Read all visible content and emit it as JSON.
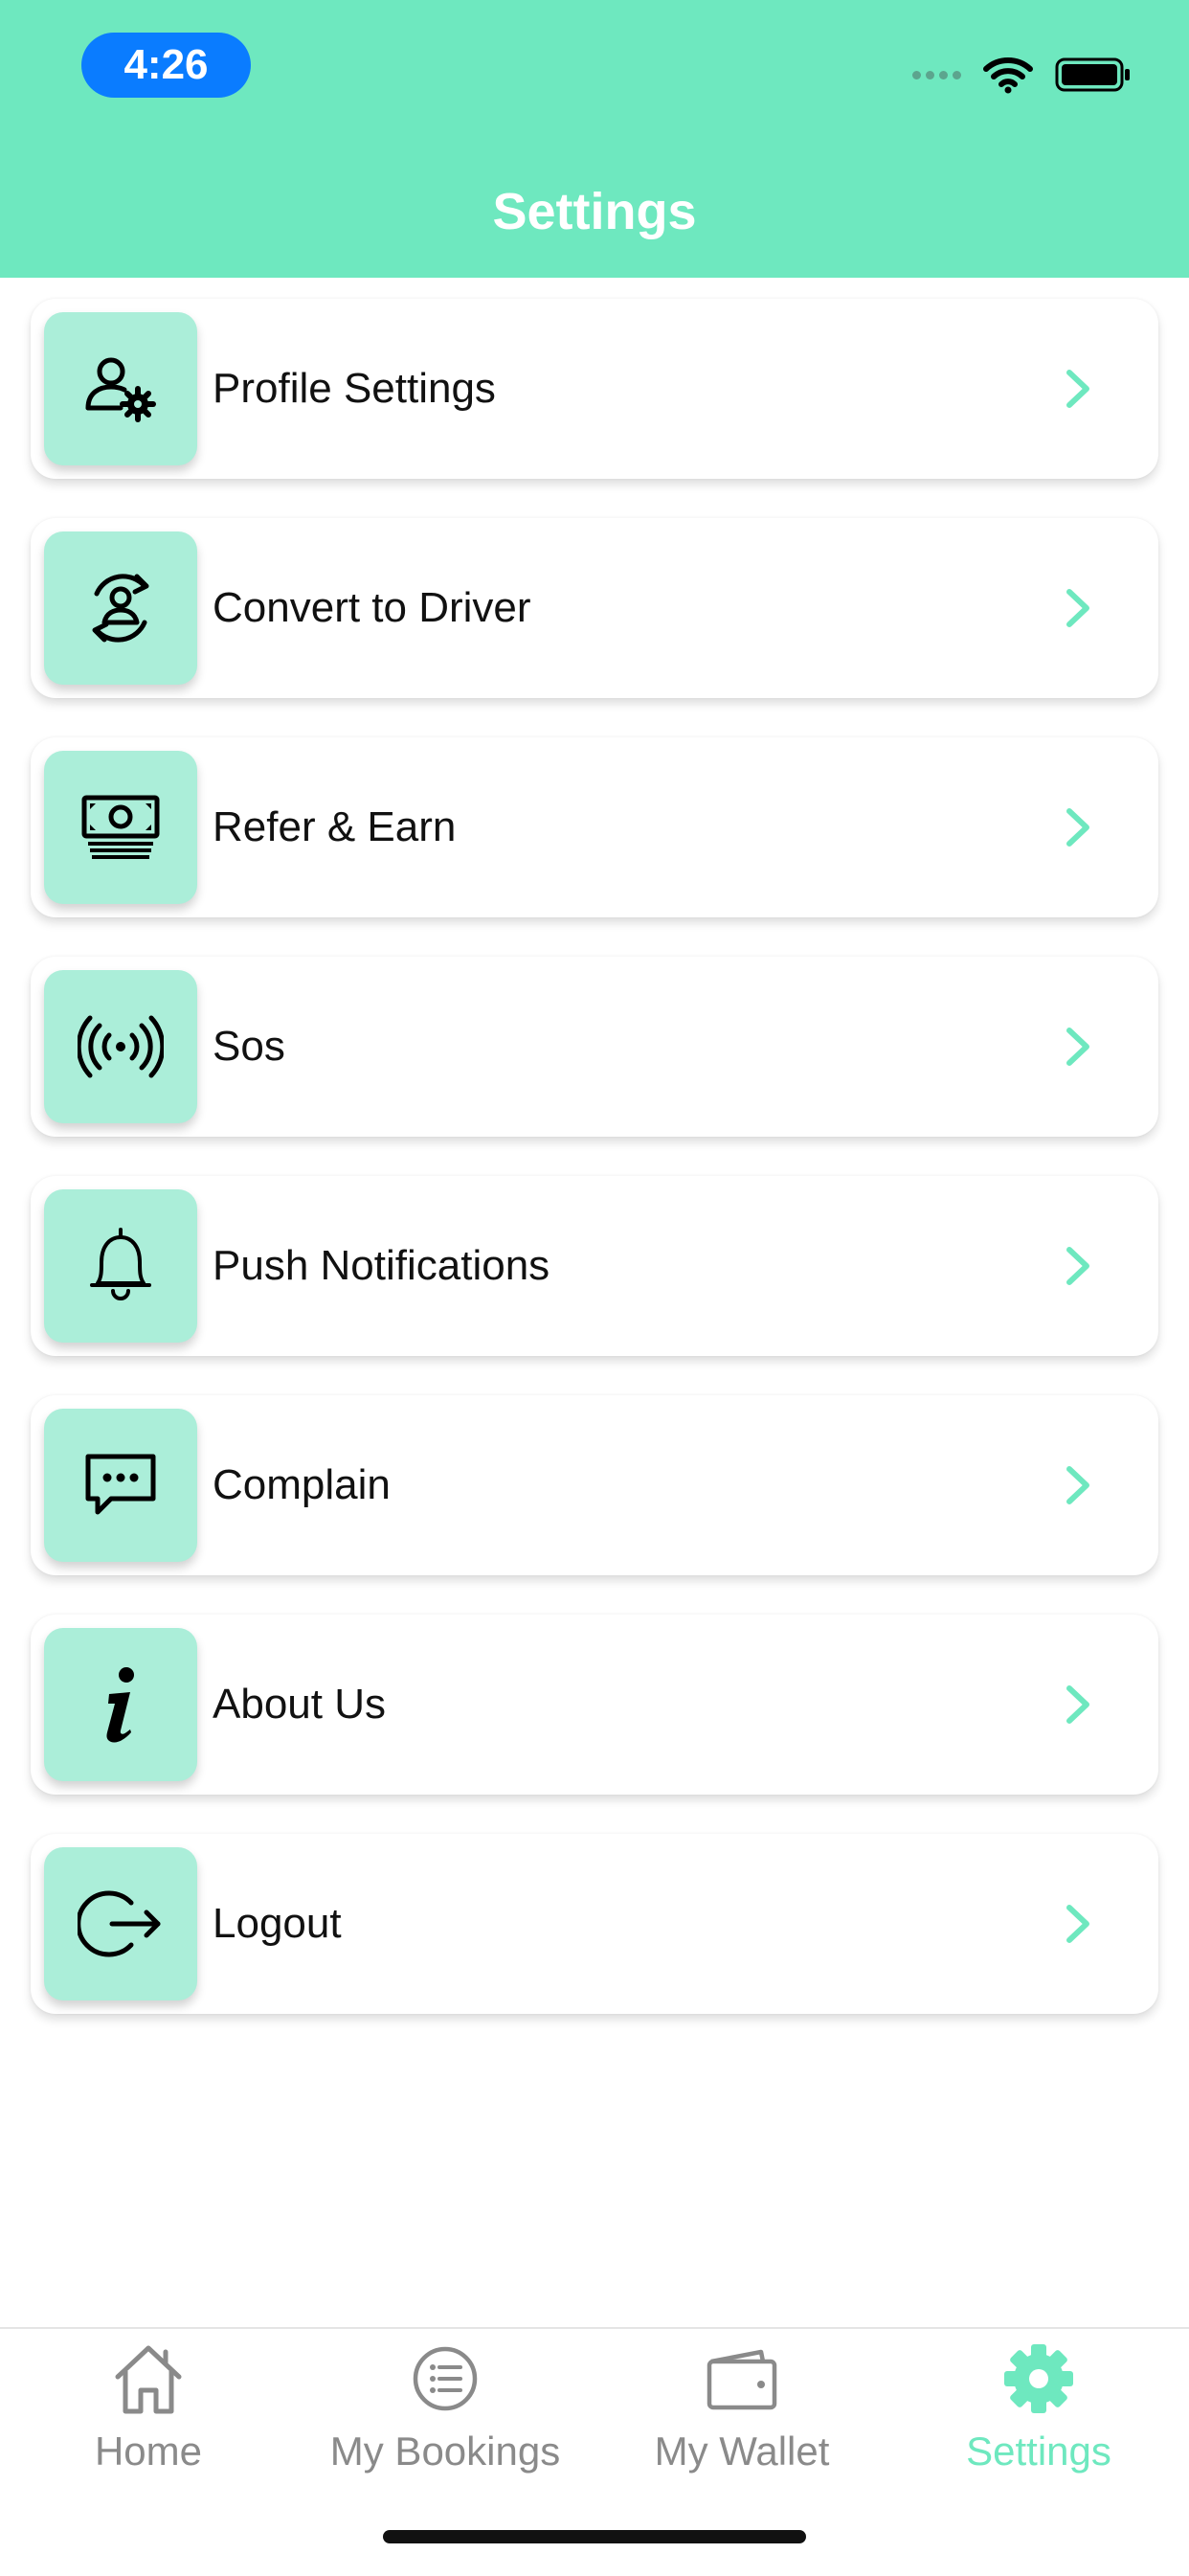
{
  "status_bar": {
    "time": "4:26"
  },
  "header": {
    "title": "Settings"
  },
  "colors": {
    "accent": "#6ee8bf",
    "icon_bg": "#abeed9",
    "inactive": "#8a8a8a"
  },
  "settings_items": [
    {
      "label": "Profile Settings",
      "icon": "user-gear-icon"
    },
    {
      "label": "Convert to Driver",
      "icon": "switch-user-icon"
    },
    {
      "label": "Refer & Earn",
      "icon": "money-stack-icon"
    },
    {
      "label": "Sos",
      "icon": "broadcast-icon"
    },
    {
      "label": "Push Notifications",
      "icon": "bell-icon"
    },
    {
      "label": "Complain",
      "icon": "chat-bubble-icon"
    },
    {
      "label": "About Us",
      "icon": "info-icon"
    },
    {
      "label": "Logout",
      "icon": "logout-icon"
    }
  ],
  "tab_bar": {
    "tabs": [
      {
        "label": "Home",
        "icon": "home-icon",
        "active": false
      },
      {
        "label": "My Bookings",
        "icon": "list-icon",
        "active": false
      },
      {
        "label": "My Wallet",
        "icon": "wallet-icon",
        "active": false
      },
      {
        "label": "Settings",
        "icon": "gear-icon",
        "active": true
      }
    ]
  }
}
